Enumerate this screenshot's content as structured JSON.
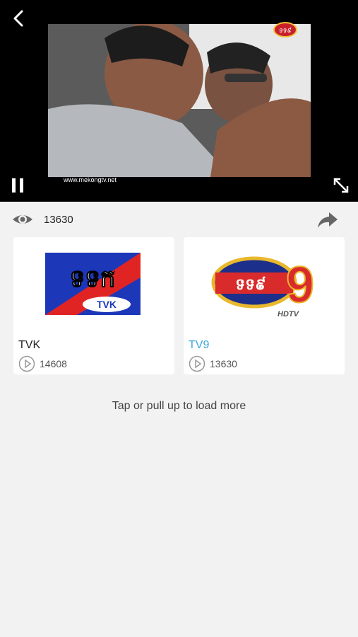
{
  "player": {
    "watermark": "www.mekongtv.net",
    "bug_label": "ទទ៩"
  },
  "stats": {
    "views": "13630"
  },
  "channels": [
    {
      "name": "TVK",
      "logo_text": "ទទក",
      "logo_sub": "TVK",
      "plays": "14608"
    },
    {
      "name": "TV9",
      "logo_text": "ទទ៩",
      "logo_sub": "HDTV",
      "plays": "13630"
    }
  ],
  "footer": {
    "load_more": "Tap or pull up to load more"
  },
  "colors": {
    "accent": "#3ea5d8"
  }
}
